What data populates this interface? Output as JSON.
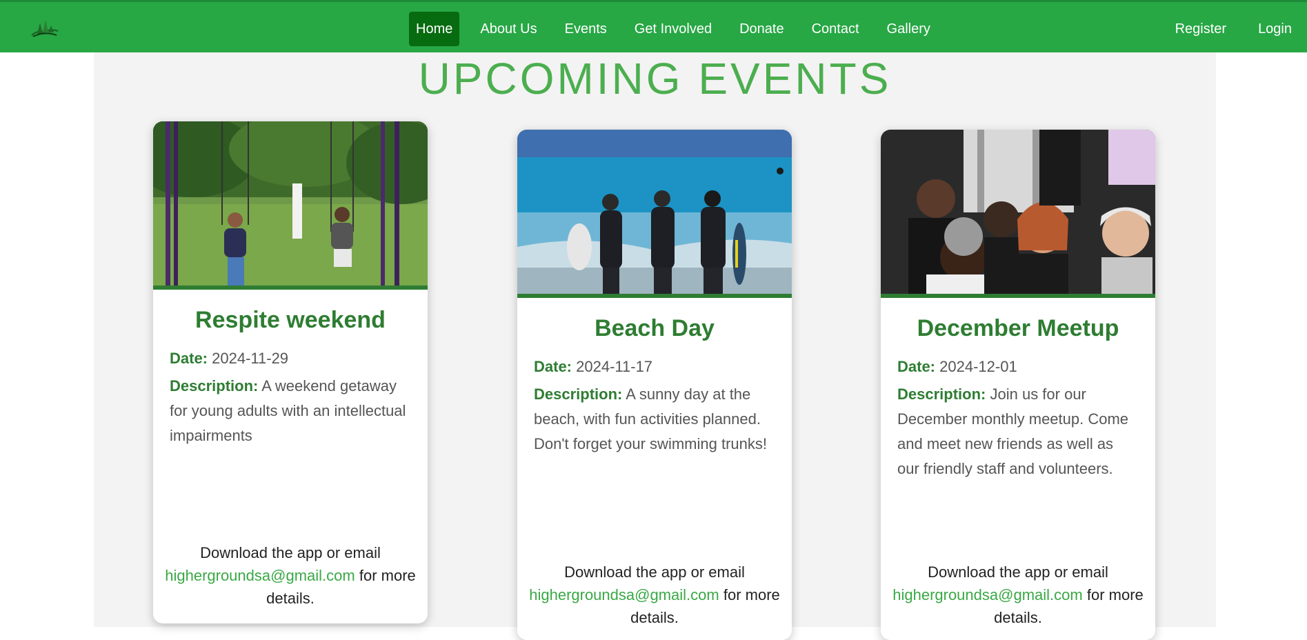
{
  "nav": {
    "logo_icon": "trees-logo-icon",
    "links": [
      "Home",
      "About Us",
      "Events",
      "Get Involved",
      "Donate",
      "Contact",
      "Gallery"
    ],
    "active": "Home",
    "right": [
      "Register",
      "Login"
    ]
  },
  "page": {
    "title": "UPCOMING EVENTS"
  },
  "events": [
    {
      "title": "Respite weekend",
      "date_label": "Date:",
      "date": "2024-11-29",
      "desc_label": "Description:",
      "description": "A weekend getaway for young adults with an intellectual impairments",
      "footer_pre": "Download the app or email",
      "email": "highergroundsa@gmail.com",
      "footer_post": "for more details.",
      "image": "people-on-swings-photo"
    },
    {
      "title": "Beach Day",
      "date_label": "Date:",
      "date": "2024-11-17",
      "desc_label": "Description:",
      "description": "A sunny day at the beach, with fun activities planned. Don't forget your swimming trunks!",
      "footer_pre": "Download the app or email",
      "email": "highergroundsa@gmail.com",
      "footer_post": "for more details.",
      "image": "surfers-at-beach-photo"
    },
    {
      "title": "December Meetup",
      "date_label": "Date:",
      "date": "2024-12-01",
      "desc_label": "Description:",
      "description": "Join us for our December monthly meetup. Come and meet new friends as well as our friendly staff and volunteers.",
      "footer_pre": "Download the app or email",
      "email": "highergroundsa@gmail.com",
      "footer_post": "for more details.",
      "image": "group-meetup-photo"
    }
  ],
  "colors": {
    "nav_bg": "#28a745",
    "nav_active": "#076b10",
    "title_green": "#4cae4f",
    "label_green": "#2e7d32",
    "email_green": "#3aa845"
  }
}
